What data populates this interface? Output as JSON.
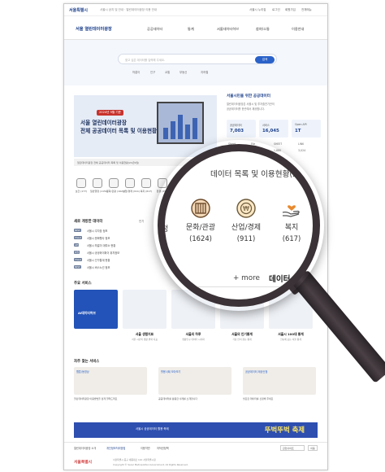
{
  "topbar": {
    "logo": "서울특별시",
    "notice": "서울시 공지 및 안내 · 열린데이터광장 이용 안내",
    "util": [
      "서울시 누리집",
      "로그인",
      "회원가입",
      "전체메뉴"
    ]
  },
  "header": {
    "brand": "서울 열린데이터광장",
    "gnb": [
      "공공데이터",
      "통계",
      "서울데이터허브",
      "참여/소통",
      "이용안내"
    ]
  },
  "search": {
    "placeholder": "찾고 싶은 데이터를 입력해 주세요.",
    "button": "검색",
    "tags": [
      "따릉이",
      "인구",
      "교통",
      "부동산",
      "지하철"
    ]
  },
  "banner": {
    "badge": "2024년 9월 기준",
    "line1": "서울 열린데이터광장",
    "line2": "전체 공공데이터 목록 및 이용현황",
    "caption": "열린데이터광장 전체 공공데이터 목록 및 이용현황(24년9월)"
  },
  "stats": {
    "title": "서울시민을 위한 공공데이터",
    "desc1": "열린데이터광장은 서울시 및 투자출연기관의",
    "desc2": "공공데이터를 한곳에서 제공합니다.",
    "cards": [
      {
        "label": "공공데이터",
        "value": "7,003"
      },
      {
        "label": "서비스",
        "value": "16,045"
      },
      {
        "label": "Open API",
        "value": "1T"
      }
    ],
    "rows": [
      [
        "Sheet",
        "File",
        "SHEET",
        "LINK"
      ],
      [
        "6,240",
        "2,114",
        "1,880",
        "3,024"
      ]
    ]
  },
  "categories": [
    "보건\n(177)",
    "일반행정\n(1151)",
    "문화/관광\n(1624)",
    "산업/경제\n(911)",
    "복지\n(617)",
    "환경\n(452)",
    "교통\n(890)",
    "안전\n(311)",
    "주택\n(204)"
  ],
  "newdata": {
    "title": "새로 개방한 데이터",
    "tab": "인기",
    "items": [
      {
        "badge": "NEW",
        "text": "서울시 주차장 정보"
      },
      {
        "badge": "Sheet",
        "text": "서울시 문화행사 정보"
      },
      {
        "badge": "API",
        "text": "서울시 따릉이 대여소 현황"
      },
      {
        "badge": "파일",
        "text": "서울시 공공와이파이 위치정보"
      },
      {
        "badge": "Sheet",
        "text": "서울시 인구통계 현황"
      },
      {
        "badge": "NEW",
        "text": "서울시 버스노선 정보"
      }
    ]
  },
  "services": {
    "title": "주요 서비스",
    "more": "+ more",
    "items": [
      {
        "name": "AI데이터허브",
        "desc": ""
      },
      {
        "name": "서울 생활지표",
        "desc": "서울 시민의 생활 변화 지표"
      },
      {
        "name": "서울의 하루",
        "desc": "생활인구 데이터 시각화"
      },
      {
        "name": "서울의 인기통계",
        "desc": "가장 많이 찾는 통계"
      },
      {
        "name": "서울시 100대 통계",
        "desc": "한눈에 보는 서울 통계"
      }
    ]
  },
  "favorites": {
    "title": "자주 찾는 서비스",
    "items": [
      {
        "label": "웹툰/동영상",
        "desc": "열린데이터광장 이용방법을 쉽게 알려드려요"
      },
      {
        "label": "활용사례 모아보기",
        "desc": "공공데이터를 활용한 사례를 소개합니다"
      },
      {
        "label": "공공데이터 제공신청",
        "desc": "필요한 데이터를 신청해 주세요"
      }
    ]
  },
  "festival": {
    "pills": "서울시 공공데이터 활용 축제",
    "title": "뚜벅뚜벅 축제"
  },
  "footer": {
    "links": [
      "열린데이터광장 소개",
      "개인정보처리방침",
      "이용약관",
      "저작권정책",
      "관련사이트"
    ],
    "select": "관련사이트",
    "go": "이동",
    "logo": "서울특별시",
    "addr1": "서울특별시 중구 세종대로 110 서울특별시청",
    "addr2": "Copyright © Seoul Metropolitan Government. All Rights Reserved."
  },
  "lens": {
    "title": "데이터 목록 및 이용현황(24년 9월)",
    "left_label": "정",
    "cats": [
      {
        "name": "문화/관광",
        "count": "(1624)"
      },
      {
        "name": "산업/경제",
        "count": "(911)"
      },
      {
        "name": "복지",
        "count": "(617)"
      }
    ],
    "more": "+ more",
    "data": "데이터"
  }
}
